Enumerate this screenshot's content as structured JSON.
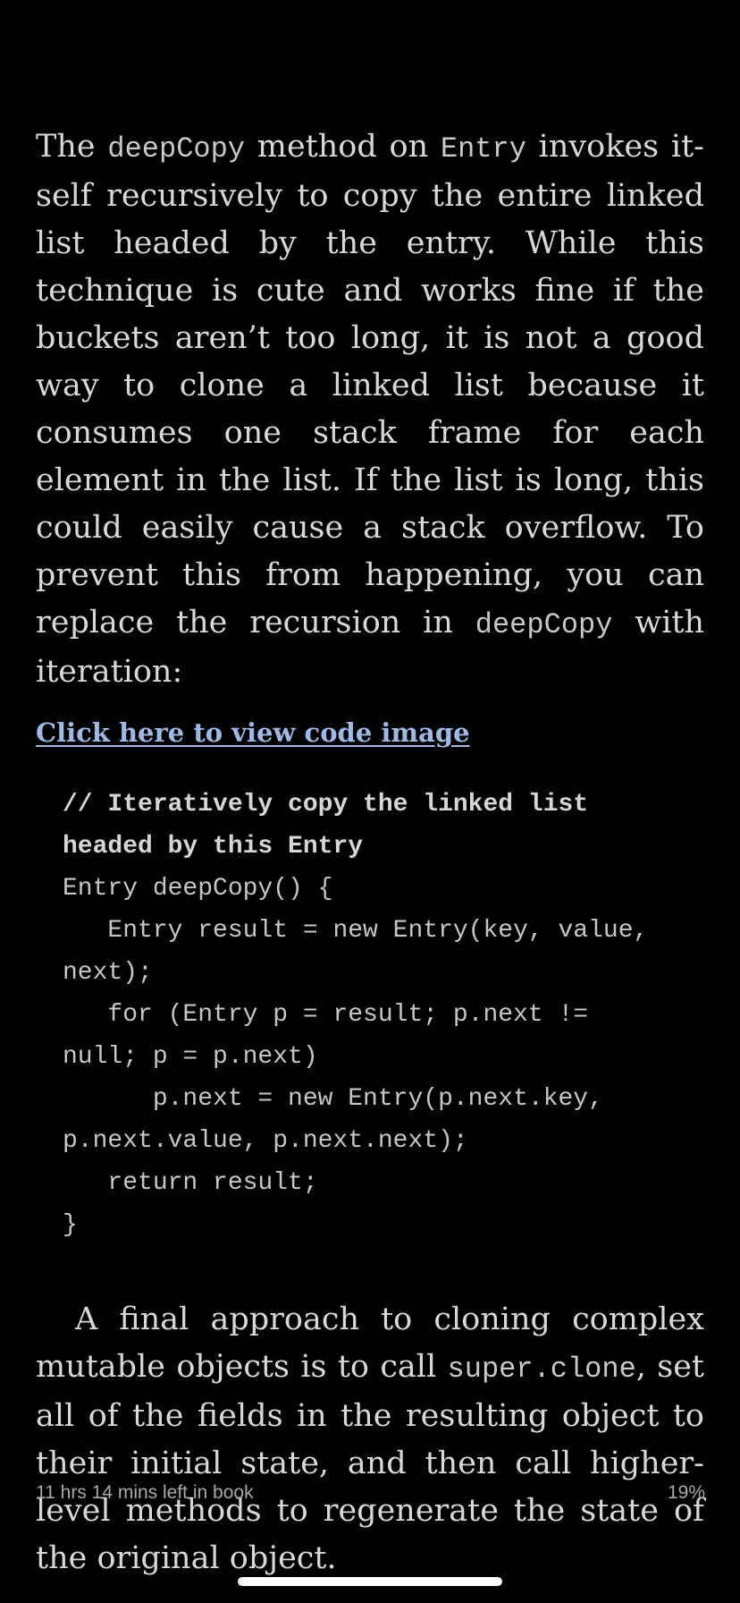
{
  "reader": {
    "paragraph1": {
      "t1": "The ",
      "c1": "deepCopy",
      "t2": " method on ",
      "c2": "Entry",
      "t3": " invokes it­self recursively to copy the entire linked list headed by the entry. While this technique is cute and works fine if the buckets aren’t too long, it is not a good way to clone a linked list because it consumes one stack frame for each element in the list. If the list is long, this could easily cause a stack overflow. To pre­vent this from happening, you can replace the recursion in ",
      "c3": "deepCopy",
      "t4": " with iteration:"
    },
    "code_link": "Click here to view code image",
    "code_lines": [
      "// Iteratively copy the linked list",
      "headed by this Entry",
      "Entry deepCopy() {",
      "   Entry result = new Entry(key, value,",
      "next);",
      "   for (Entry p = result; p.next !=",
      "null; p = p.next)",
      "      p.next = new Entry(p.next.key,",
      "p.next.value, p.next.next);",
      "   return result;",
      "}"
    ],
    "paragraph2": {
      "t1": "A final approach to cloning complex mut­able objects is to call ",
      "c1": "super.clone",
      "t2": ", set all of the fields in the resulting object to their ini­tial state, and then call higher-level methods to regenerate the state of the original object."
    }
  },
  "footer": {
    "time_left": "11 hrs 14 mins left in book",
    "progress": "19%"
  },
  "colors": {
    "background": "#000000",
    "text": "#d8d8d8",
    "link": "#9fb9e6"
  }
}
